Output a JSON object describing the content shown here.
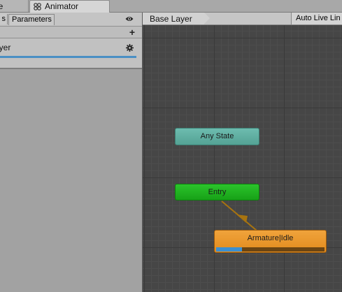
{
  "tabs": {
    "scene_label": "ne",
    "animator_label": "Animator",
    "animator_icon": "animator-icon"
  },
  "left_panel": {
    "layers_tab_label": "s",
    "parameters_tab_label": "Parameters",
    "visibility_icon": "eye-icon",
    "add_icon": "plus-icon",
    "add_label": "+",
    "layer": {
      "name": "ayer",
      "settings_icon": "gear-icon",
      "weight_bar_color": "#4a8fc4"
    }
  },
  "graph": {
    "breadcrumb": "Base Layer",
    "live_link_label": "Auto Live Lin",
    "background_color": "#464646",
    "states": {
      "any_state": {
        "label": "Any State",
        "color": "#5fb0a2"
      },
      "entry": {
        "label": "Entry",
        "color": "#1fae1f"
      },
      "default_state": {
        "label": "Armature|Idle",
        "color": "#e8952a",
        "progress": 0.24
      }
    },
    "transition_color": "#a8740f"
  }
}
